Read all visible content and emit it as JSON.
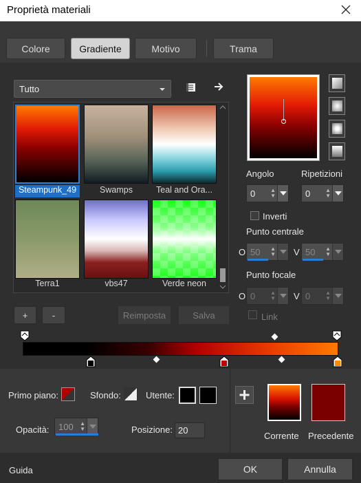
{
  "window": {
    "title": "Proprietà materiali"
  },
  "tabs": [
    "Colore",
    "Gradiente",
    "Motivo",
    "Trama"
  ],
  "filter": {
    "selected": "Tutto"
  },
  "gallery": {
    "items": [
      {
        "label": "Steampunk_49",
        "selected": true
      },
      {
        "label": "Swamps",
        "selected": false
      },
      {
        "label": "Teal and Ora...",
        "selected": false
      },
      {
        "label": "Terra1",
        "selected": false
      },
      {
        "label": "vbs47",
        "selected": false
      },
      {
        "label": "Verde neon",
        "selected": false
      }
    ]
  },
  "buttons": {
    "add": "+",
    "remove": "-",
    "reset": "Reimposta",
    "save": "Salva"
  },
  "angle": {
    "label": "Angolo",
    "value": "0"
  },
  "repeats": {
    "label": "Ripetizioni",
    "value": "0"
  },
  "invert": {
    "label": "Inverti"
  },
  "center": {
    "label": "Punto centrale",
    "o_label": "O",
    "o_value": "50",
    "v_label": "V",
    "v_value": "50"
  },
  "focal": {
    "label": "Punto focale",
    "o_label": "O",
    "o_value": "0",
    "v_label": "V",
    "v_value": "0"
  },
  "link": {
    "label": "Link"
  },
  "bottom": {
    "foreground_label": "Primo piano:",
    "background_label": "Sfondo:",
    "user_label": "Utente:",
    "opacity_label": "Opacità:",
    "opacity_value": "100",
    "position_label": "Posizione:",
    "position_value": "20",
    "current_label": "Corrente",
    "previous_label": "Precedente",
    "previous_color": "#7a0000"
  },
  "footer": {
    "help": "Guida",
    "ok": "OK",
    "cancel": "Annulla"
  }
}
